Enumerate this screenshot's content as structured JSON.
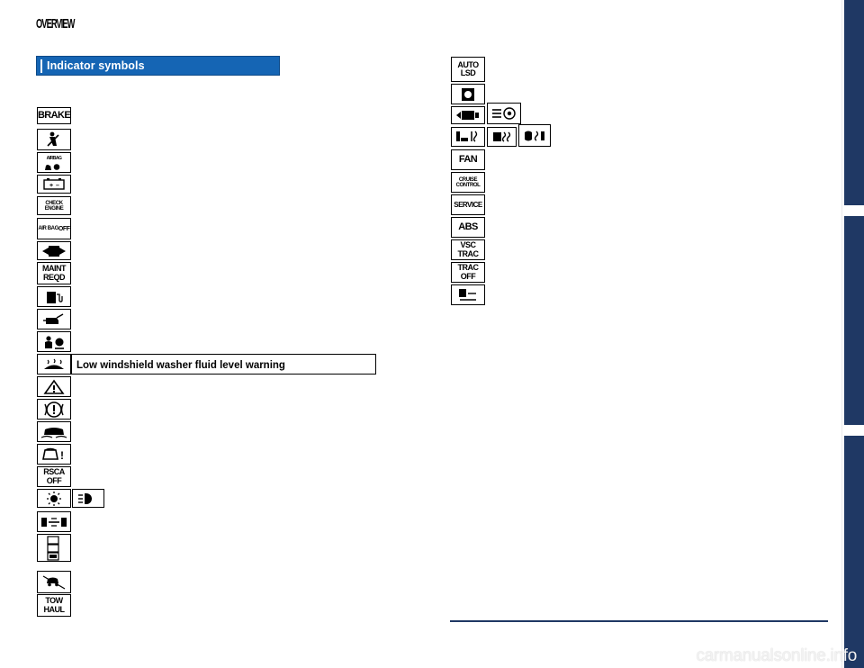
{
  "page": {
    "chapter_title": "OVERVIEW",
    "section_title": "Indicator symbols",
    "watermark": "carmanualsonline.info"
  },
  "tooltip": {
    "text": "Low windshield washer fluid level warning"
  },
  "left_column_symbols": [
    {
      "name": "brake-warning",
      "label": "BRAKE",
      "style": "big"
    },
    {
      "name": "seatbelt-warning",
      "label": "",
      "style": "icon-seatbelt"
    },
    {
      "name": "srs-airbag-warning",
      "label": "AIRBAG",
      "style": "icon-airbag"
    },
    {
      "name": "charging-system-warning",
      "label": "",
      "style": "icon-battery"
    },
    {
      "name": "check-engine-warning",
      "label": "CHECK ENGINE",
      "style": "two"
    },
    {
      "name": "air-bag-off-indicator",
      "label": "AIR BAG OFF",
      "style": "tiny"
    },
    {
      "name": "open-door-warning",
      "label": "",
      "style": "icon-door"
    },
    {
      "name": "maintenance-required-indicator",
      "label": "MAINT REQD",
      "style": "two"
    },
    {
      "name": "low-fuel-level-warning",
      "label": "",
      "style": "icon-fuel"
    },
    {
      "name": "engine-oil-pressure-warning",
      "label": "",
      "style": "icon-oil"
    },
    {
      "name": "passenger-airbag-indicator",
      "label": "",
      "style": "icon-pass-airbag"
    },
    {
      "name": "low-washer-fluid-warning",
      "label": "",
      "style": "icon-washer"
    },
    {
      "name": "master-warning",
      "label": "",
      "style": "icon-master-warning"
    },
    {
      "name": "parking-brake-warning",
      "label": "",
      "style": "icon-parking-brake"
    },
    {
      "name": "vsc-off-indicator",
      "label": "",
      "style": "icon-vsc"
    },
    {
      "name": "tire-pressure-warning",
      "label": "",
      "style": "icon-tpms"
    },
    {
      "name": "rsca-off-indicator",
      "label": "RSCA OFF",
      "style": "two"
    },
    {
      "name": "headlight-indicator",
      "label": "",
      "style": "icon-headlight"
    },
    {
      "name": "high-beam-indicator",
      "label": "",
      "style": "icon-highbeam"
    },
    {
      "name": "four-wheel-drive-indicator",
      "label": "",
      "style": "icon-4wd"
    },
    {
      "name": "a-trac-indicator",
      "label": "",
      "style": "icon-atrac"
    },
    {
      "name": "downhill-assist-indicator",
      "label": "",
      "style": "icon-downhill"
    },
    {
      "name": "tow-haul-indicator",
      "label": "TOW HAUL",
      "style": "two"
    }
  ],
  "right_column_symbols": [
    {
      "name": "auto-lsd-indicator",
      "label": "AUTO LSD",
      "style": "two"
    },
    {
      "name": "slip-indicator",
      "label": "",
      "style": "icon-slip"
    },
    {
      "name": "rear-differential-lock-indicator",
      "label": "",
      "style": "icon-diff-lock"
    },
    {
      "name": "crawl-control-indicator",
      "label": "",
      "style": "icon-crawl"
    },
    {
      "name": "seat-heater-indicator",
      "label": "",
      "style": "icon-seat-heater"
    },
    {
      "name": "rear-window-defogger-indicator",
      "label": "",
      "style": "icon-defogger"
    },
    {
      "name": "side-mirror-defogger-indicator",
      "label": "",
      "style": "icon-mirror-defog"
    },
    {
      "name": "pre-collision-indicator",
      "label": "",
      "style": "icon-precollision"
    },
    {
      "name": "fan-indicator",
      "label": "FAN",
      "style": "big"
    },
    {
      "name": "cruise-control-indicator",
      "label": "CRUISE",
      "style": "two"
    },
    {
      "name": "service-indicator",
      "label": "SERVICE",
      "style": "tiny"
    },
    {
      "name": "abs-warning",
      "label": "ABS",
      "style": "big"
    },
    {
      "name": "vsc-trac-off-indicator",
      "label": "VSC TRAC",
      "style": "two"
    },
    {
      "name": "trac-off-indicator",
      "label": "TRAC OFF",
      "style": "two"
    },
    {
      "name": "security-indicator",
      "label": "",
      "style": "icon-security"
    }
  ]
}
